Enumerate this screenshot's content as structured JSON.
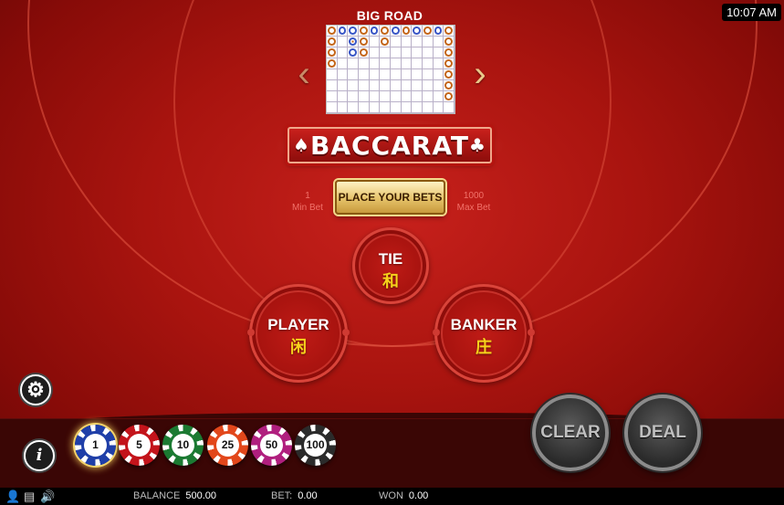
{
  "clock": "10:07 AM",
  "big_road": {
    "title": "BIG ROAD",
    "rows": 8,
    "cols": 12,
    "marks": [
      {
        "c": 0,
        "r": 0,
        "t": "b"
      },
      {
        "c": 0,
        "r": 1,
        "t": "b"
      },
      {
        "c": 0,
        "r": 2,
        "t": "b"
      },
      {
        "c": 0,
        "r": 3,
        "t": "b"
      },
      {
        "c": 1,
        "r": 0,
        "t": "p"
      },
      {
        "c": 2,
        "r": 0,
        "t": "p"
      },
      {
        "c": 2,
        "r": 1,
        "t": "t"
      },
      {
        "c": 2,
        "r": 2,
        "t": "p"
      },
      {
        "c": 3,
        "r": 0,
        "t": "b"
      },
      {
        "c": 3,
        "r": 1,
        "t": "b"
      },
      {
        "c": 3,
        "r": 2,
        "t": "b"
      },
      {
        "c": 4,
        "r": 0,
        "t": "p"
      },
      {
        "c": 5,
        "r": 0,
        "t": "b"
      },
      {
        "c": 5,
        "r": 1,
        "t": "b"
      },
      {
        "c": 6,
        "r": 0,
        "t": "p"
      },
      {
        "c": 7,
        "r": 0,
        "t": "b"
      },
      {
        "c": 8,
        "r": 0,
        "t": "p"
      },
      {
        "c": 9,
        "r": 0,
        "t": "b"
      },
      {
        "c": 10,
        "r": 0,
        "t": "p"
      },
      {
        "c": 11,
        "r": 0,
        "t": "b"
      },
      {
        "c": 11,
        "r": 1,
        "t": "b"
      },
      {
        "c": 11,
        "r": 2,
        "t": "b"
      },
      {
        "c": 11,
        "r": 3,
        "t": "b"
      },
      {
        "c": 11,
        "r": 4,
        "t": "b"
      },
      {
        "c": 11,
        "r": 5,
        "t": "b"
      },
      {
        "c": 11,
        "r": 6,
        "t": "b"
      }
    ]
  },
  "logo": {
    "text": "BACCARAT",
    "left_suit": "♠",
    "right_suit": "♣"
  },
  "limits": {
    "min_value": "1",
    "min_label": "Min Bet",
    "max_value": "1000",
    "max_label": "Max Bet"
  },
  "place_bets": "PLACE YOUR BETS",
  "bets": {
    "tie": {
      "label": "TIE",
      "cn": "和"
    },
    "player": {
      "label": "PLAYER",
      "cn": "闲"
    },
    "banker": {
      "label": "BANKER",
      "cn": "庄"
    }
  },
  "chips": [
    {
      "value": "1",
      "color": "#1f3fa8",
      "selected": true
    },
    {
      "value": "5",
      "color": "#c3141b",
      "selected": false
    },
    {
      "value": "10",
      "color": "#1b7a32",
      "selected": false
    },
    {
      "value": "25",
      "color": "#e2471b",
      "selected": false
    },
    {
      "value": "50",
      "color": "#b01f7e",
      "selected": false
    },
    {
      "value": "100",
      "color": "#2b2b2b",
      "selected": false
    }
  ],
  "buttons": {
    "clear": "CLEAR",
    "deal": "DEAL"
  },
  "status": {
    "balance_label": "BALANCE",
    "balance_value": "500.00",
    "bet_label": "BET:",
    "bet_value": "0.00",
    "won_label": "WON",
    "won_value": "0.00"
  },
  "icons": {
    "settings": "gear-icon",
    "info": "info-icon",
    "user": "user-icon",
    "history": "document-icon",
    "sound": "speaker-icon"
  }
}
